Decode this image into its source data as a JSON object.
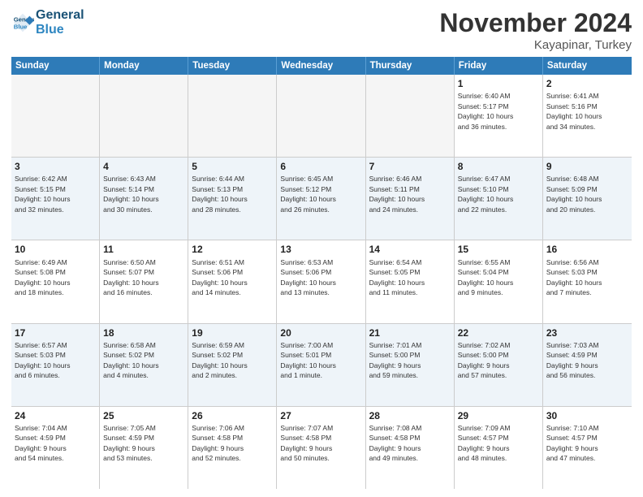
{
  "logo": {
    "line1": "General",
    "line2": "Blue"
  },
  "title": "November 2024",
  "location": "Kayapinar, Turkey",
  "days_header": [
    "Sunday",
    "Monday",
    "Tuesday",
    "Wednesday",
    "Thursday",
    "Friday",
    "Saturday"
  ],
  "rows": [
    {
      "alt": false,
      "cells": [
        {
          "day": "",
          "text": ""
        },
        {
          "day": "",
          "text": ""
        },
        {
          "day": "",
          "text": ""
        },
        {
          "day": "",
          "text": ""
        },
        {
          "day": "",
          "text": ""
        },
        {
          "day": "1",
          "text": "Sunrise: 6:40 AM\nSunset: 5:17 PM\nDaylight: 10 hours\nand 36 minutes."
        },
        {
          "day": "2",
          "text": "Sunrise: 6:41 AM\nSunset: 5:16 PM\nDaylight: 10 hours\nand 34 minutes."
        }
      ]
    },
    {
      "alt": true,
      "cells": [
        {
          "day": "3",
          "text": "Sunrise: 6:42 AM\nSunset: 5:15 PM\nDaylight: 10 hours\nand 32 minutes."
        },
        {
          "day": "4",
          "text": "Sunrise: 6:43 AM\nSunset: 5:14 PM\nDaylight: 10 hours\nand 30 minutes."
        },
        {
          "day": "5",
          "text": "Sunrise: 6:44 AM\nSunset: 5:13 PM\nDaylight: 10 hours\nand 28 minutes."
        },
        {
          "day": "6",
          "text": "Sunrise: 6:45 AM\nSunset: 5:12 PM\nDaylight: 10 hours\nand 26 minutes."
        },
        {
          "day": "7",
          "text": "Sunrise: 6:46 AM\nSunset: 5:11 PM\nDaylight: 10 hours\nand 24 minutes."
        },
        {
          "day": "8",
          "text": "Sunrise: 6:47 AM\nSunset: 5:10 PM\nDaylight: 10 hours\nand 22 minutes."
        },
        {
          "day": "9",
          "text": "Sunrise: 6:48 AM\nSunset: 5:09 PM\nDaylight: 10 hours\nand 20 minutes."
        }
      ]
    },
    {
      "alt": false,
      "cells": [
        {
          "day": "10",
          "text": "Sunrise: 6:49 AM\nSunset: 5:08 PM\nDaylight: 10 hours\nand 18 minutes."
        },
        {
          "day": "11",
          "text": "Sunrise: 6:50 AM\nSunset: 5:07 PM\nDaylight: 10 hours\nand 16 minutes."
        },
        {
          "day": "12",
          "text": "Sunrise: 6:51 AM\nSunset: 5:06 PM\nDaylight: 10 hours\nand 14 minutes."
        },
        {
          "day": "13",
          "text": "Sunrise: 6:53 AM\nSunset: 5:06 PM\nDaylight: 10 hours\nand 13 minutes."
        },
        {
          "day": "14",
          "text": "Sunrise: 6:54 AM\nSunset: 5:05 PM\nDaylight: 10 hours\nand 11 minutes."
        },
        {
          "day": "15",
          "text": "Sunrise: 6:55 AM\nSunset: 5:04 PM\nDaylight: 10 hours\nand 9 minutes."
        },
        {
          "day": "16",
          "text": "Sunrise: 6:56 AM\nSunset: 5:03 PM\nDaylight: 10 hours\nand 7 minutes."
        }
      ]
    },
    {
      "alt": true,
      "cells": [
        {
          "day": "17",
          "text": "Sunrise: 6:57 AM\nSunset: 5:03 PM\nDaylight: 10 hours\nand 6 minutes."
        },
        {
          "day": "18",
          "text": "Sunrise: 6:58 AM\nSunset: 5:02 PM\nDaylight: 10 hours\nand 4 minutes."
        },
        {
          "day": "19",
          "text": "Sunrise: 6:59 AM\nSunset: 5:02 PM\nDaylight: 10 hours\nand 2 minutes."
        },
        {
          "day": "20",
          "text": "Sunrise: 7:00 AM\nSunset: 5:01 PM\nDaylight: 10 hours\nand 1 minute."
        },
        {
          "day": "21",
          "text": "Sunrise: 7:01 AM\nSunset: 5:00 PM\nDaylight: 9 hours\nand 59 minutes."
        },
        {
          "day": "22",
          "text": "Sunrise: 7:02 AM\nSunset: 5:00 PM\nDaylight: 9 hours\nand 57 minutes."
        },
        {
          "day": "23",
          "text": "Sunrise: 7:03 AM\nSunset: 4:59 PM\nDaylight: 9 hours\nand 56 minutes."
        }
      ]
    },
    {
      "alt": false,
      "cells": [
        {
          "day": "24",
          "text": "Sunrise: 7:04 AM\nSunset: 4:59 PM\nDaylight: 9 hours\nand 54 minutes."
        },
        {
          "day": "25",
          "text": "Sunrise: 7:05 AM\nSunset: 4:59 PM\nDaylight: 9 hours\nand 53 minutes."
        },
        {
          "day": "26",
          "text": "Sunrise: 7:06 AM\nSunset: 4:58 PM\nDaylight: 9 hours\nand 52 minutes."
        },
        {
          "day": "27",
          "text": "Sunrise: 7:07 AM\nSunset: 4:58 PM\nDaylight: 9 hours\nand 50 minutes."
        },
        {
          "day": "28",
          "text": "Sunrise: 7:08 AM\nSunset: 4:58 PM\nDaylight: 9 hours\nand 49 minutes."
        },
        {
          "day": "29",
          "text": "Sunrise: 7:09 AM\nSunset: 4:57 PM\nDaylight: 9 hours\nand 48 minutes."
        },
        {
          "day": "30",
          "text": "Sunrise: 7:10 AM\nSunset: 4:57 PM\nDaylight: 9 hours\nand 47 minutes."
        }
      ]
    }
  ]
}
